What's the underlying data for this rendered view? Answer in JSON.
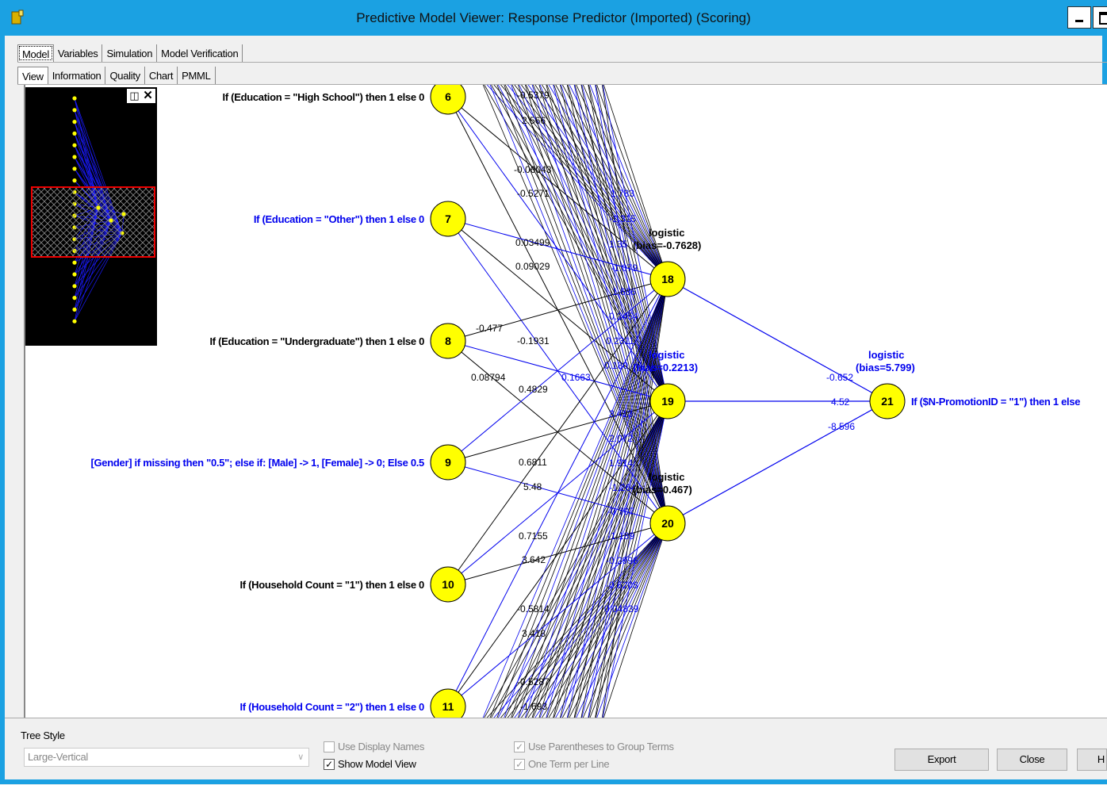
{
  "window": {
    "title": "Predictive Model Viewer: Response Predictor (Imported) (Scoring)"
  },
  "tabs_main": [
    "Model",
    "Variables",
    "Simulation",
    "Model Verification"
  ],
  "tabs_sub": [
    "View",
    "Information",
    "Quality",
    "Chart",
    "PMML"
  ],
  "inputs": [
    {
      "id": "6",
      "label": "If (Education = \"High School\") then 1 else 0",
      "color": "#000000"
    },
    {
      "id": "7",
      "label": "If (Education = \"Other\") then 1 else 0",
      "color": "#0000ee"
    },
    {
      "id": "8",
      "label": "If (Education = \"Undergraduate\") then 1 else 0",
      "color": "#000000"
    },
    {
      "id": "9",
      "label": "[Gender] if missing then \"0.5\"; else if: [Male] -> 1, [Female] -> 0; Else 0.5",
      "color": "#0000ee"
    },
    {
      "id": "10",
      "label": "If (Household Count = \"1\") then 1 else 0",
      "color": "#000000"
    },
    {
      "id": "11",
      "label": "If (Household Count = \"2\") then 1 else 0",
      "color": "#0000ee"
    }
  ],
  "hidden": [
    {
      "id": "18",
      "func": "logistic",
      "bias": "(bias=-0.7628)",
      "color": "#000000"
    },
    {
      "id": "19",
      "func": "logistic",
      "bias": "(bias=0.2213)",
      "color": "#0000ee"
    },
    {
      "id": "20",
      "func": "logistic",
      "bias": "(bias=0.467)",
      "color": "#000000"
    }
  ],
  "output": {
    "id": "21",
    "func": "logistic",
    "bias": "(bias=5.799)",
    "label": "If ($N-PromotionID = \"1\") then 1 else",
    "color": "#0000ee"
  },
  "weights_black": [
    "-0.5379",
    "2.566",
    "-0.06043",
    "-0.5271",
    "0.03499",
    "0.09029",
    "-0.477",
    "-0.1931",
    "0.08794",
    "0.4829",
    "0.6811",
    "5.48",
    "0.7155",
    "3.642",
    "-0.5814",
    "3.418",
    "-0.5287",
    "-1.693"
  ],
  "weights_blue": [
    "1.783",
    "-1.315",
    "1.35",
    "-1.079",
    "1.686",
    "-0.2454",
    "0.2311",
    "0.180",
    "0.1663",
    "3.413",
    "2.072",
    "1.914",
    "-1.264",
    "-0.707",
    "-1.189",
    "-0.2996",
    "-0.6208",
    "0.04839"
  ],
  "weights_output": [
    "-0.652",
    "4.52",
    "-8.596"
  ],
  "bottom": {
    "tree_style_label": "Tree Style",
    "tree_style_value": "Large-Vertical",
    "use_display_names": "Use Display Names",
    "show_model_view": "Show Model View",
    "use_parentheses": "Use Parentheses to Group Terms",
    "one_term_per_line": "One Term per Line",
    "export": "Export",
    "close": "Close",
    "help_partial": "H"
  },
  "colors": {
    "titlebar": "#1ba1e2",
    "node": "#ffff00",
    "link_blue": "#0000ee"
  }
}
